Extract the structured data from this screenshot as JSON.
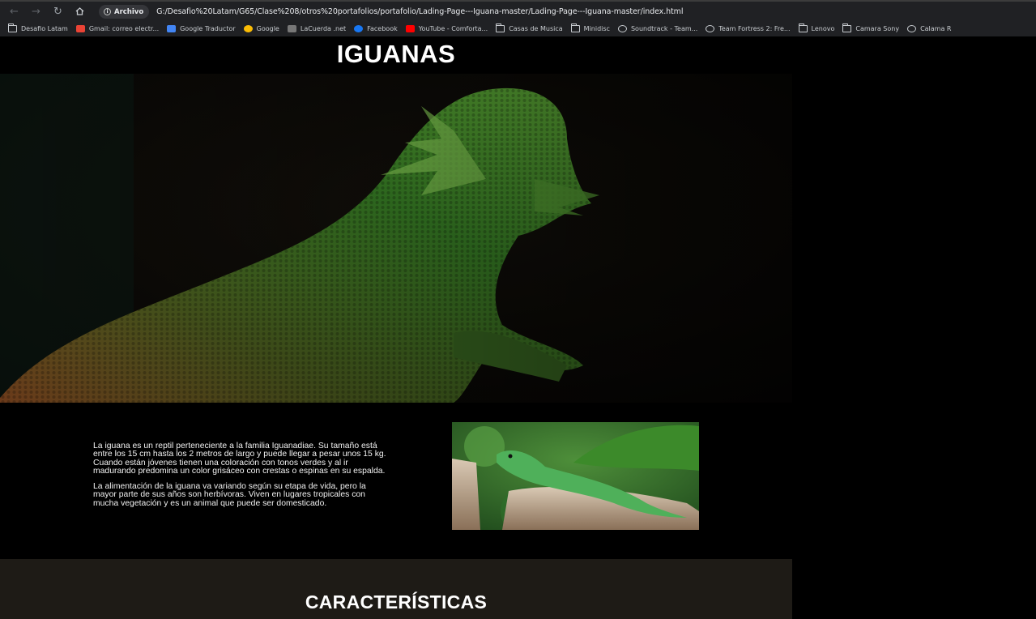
{
  "browser": {
    "chip_label": "Archivo",
    "url": "G:/Desafio%20Latam/G65/Clase%208/otros%20portafolios/portafolio/Lading-Page---Iguana-master/Lading-Page---Iguana-master/index.html",
    "bookmarks": [
      {
        "label": "Desafio Latam",
        "icon": "folder-icon"
      },
      {
        "label": "Gmail: correo electr...",
        "icon": "gmail-icon"
      },
      {
        "label": "Google Traductor",
        "icon": "translate-icon"
      },
      {
        "label": "Google",
        "icon": "google-icon"
      },
      {
        "label": "LaCuerda .net",
        "icon": "lacuerda-icon"
      },
      {
        "label": "Facebook",
        "icon": "facebook-icon"
      },
      {
        "label": "YouTube - Comforta...",
        "icon": "youtube-icon"
      },
      {
        "label": "Casas de Musica",
        "icon": "folder-icon"
      },
      {
        "label": "Minidisc",
        "icon": "folder-icon"
      },
      {
        "label": "Soundtrack - Team...",
        "icon": "globe-icon"
      },
      {
        "label": "Team Fortress 2: Fre...",
        "icon": "globe-icon"
      },
      {
        "label": "Lenovo",
        "icon": "folder-icon"
      },
      {
        "label": "Camara Sony",
        "icon": "folder-icon"
      },
      {
        "label": "Calama R",
        "icon": "globe-icon"
      }
    ]
  },
  "page": {
    "title": "IGUANAS",
    "intro_paragraphs": [
      "La iguana es un reptil perteneciente a la familia Iguanadiae. Su tamaño está entre los 15 cm hasta los 2 metros de largo y puede llegar a pesar unos 15 kg. Cuando están jóvenes tienen una coloración con tonos verdes y al ir madurando predomina un color grisáceo con crestas o espinas en su espalda.",
      "La alimentación de la iguana va variando según su etapa de vida, pero la mayor parte de sus años son herbívoras. Viven en lugares tropicales con mucha vegetación y es un animal que puede ser domesticado."
    ],
    "features_title": "CARACTERÍSTICAS"
  }
}
